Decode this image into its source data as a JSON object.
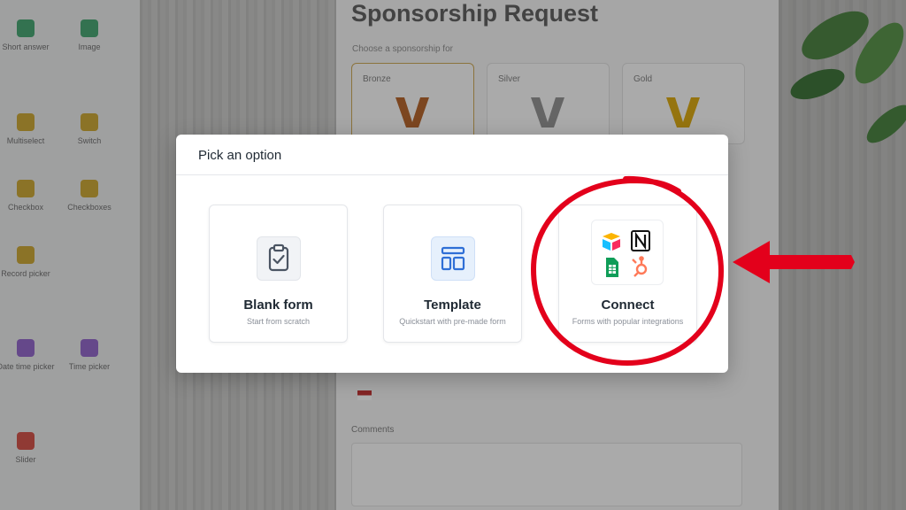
{
  "background": {
    "components": [
      {
        "label": "Short answer",
        "color": "#3aa06a"
      },
      {
        "label": "Image",
        "color": "#3aa06a"
      },
      {
        "label": "Multiselect",
        "color": "#c9a227"
      },
      {
        "label": "Switch",
        "color": "#c9a227"
      },
      {
        "label": "Checkbox",
        "color": "#c9a227"
      },
      {
        "label": "Checkboxes",
        "color": "#c9a227"
      },
      {
        "label": "Record picker",
        "color": "#c9a227"
      },
      {
        "label": "Date time picker",
        "color": "#8b5cc7"
      },
      {
        "label": "Time picker",
        "color": "#8b5cc7"
      },
      {
        "label": "Slider",
        "color": "#d0463c"
      }
    ],
    "form_title": "Sponsorship Request",
    "form_subtitle": "Choose a sponsorship for",
    "tiers": [
      "Bronze",
      "Silver",
      "Gold"
    ],
    "comments_label": "Comments"
  },
  "modal": {
    "title": "Pick an option",
    "options": [
      {
        "title": "Blank form",
        "subtitle": "Start from scratch",
        "icon": "clipboard-check-icon"
      },
      {
        "title": "Template",
        "subtitle": "Quickstart with pre-made form",
        "icon": "template-layout-icon"
      },
      {
        "title": "Connect",
        "subtitle": "Forms with popular integrations",
        "icon": "integrations-icon"
      }
    ]
  },
  "annotations": {
    "highlight_color": "#e3001b"
  }
}
